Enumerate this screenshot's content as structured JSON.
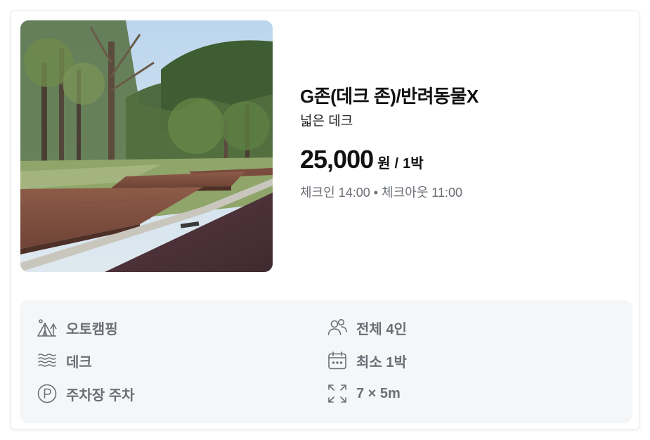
{
  "site": {
    "title": "G존(데크 존)/반려동물X",
    "subtitle": "넓은 데크",
    "price": "25,000",
    "price_unit": "원",
    "price_sep": "/",
    "price_per": "1박",
    "checkin": "체크인 14:00",
    "checkout": "체크아웃 11:00"
  },
  "features": {
    "camping_type": {
      "icon": "tent-icon",
      "label": "오토캠핑"
    },
    "capacity": {
      "icon": "people-icon",
      "label": "전체 4인"
    },
    "floor": {
      "icon": "deck-icon",
      "label": "데크"
    },
    "min_stay": {
      "icon": "calendar-icon",
      "label": "최소 1박"
    },
    "parking": {
      "icon": "parking-icon",
      "label": "주차장 주차"
    },
    "size": {
      "icon": "expand-icon",
      "label": "7 × 5m"
    }
  },
  "colors": {
    "feature_text": "#6b6f76",
    "feature_bg": "#f5f6f8",
    "title": "#111111"
  }
}
